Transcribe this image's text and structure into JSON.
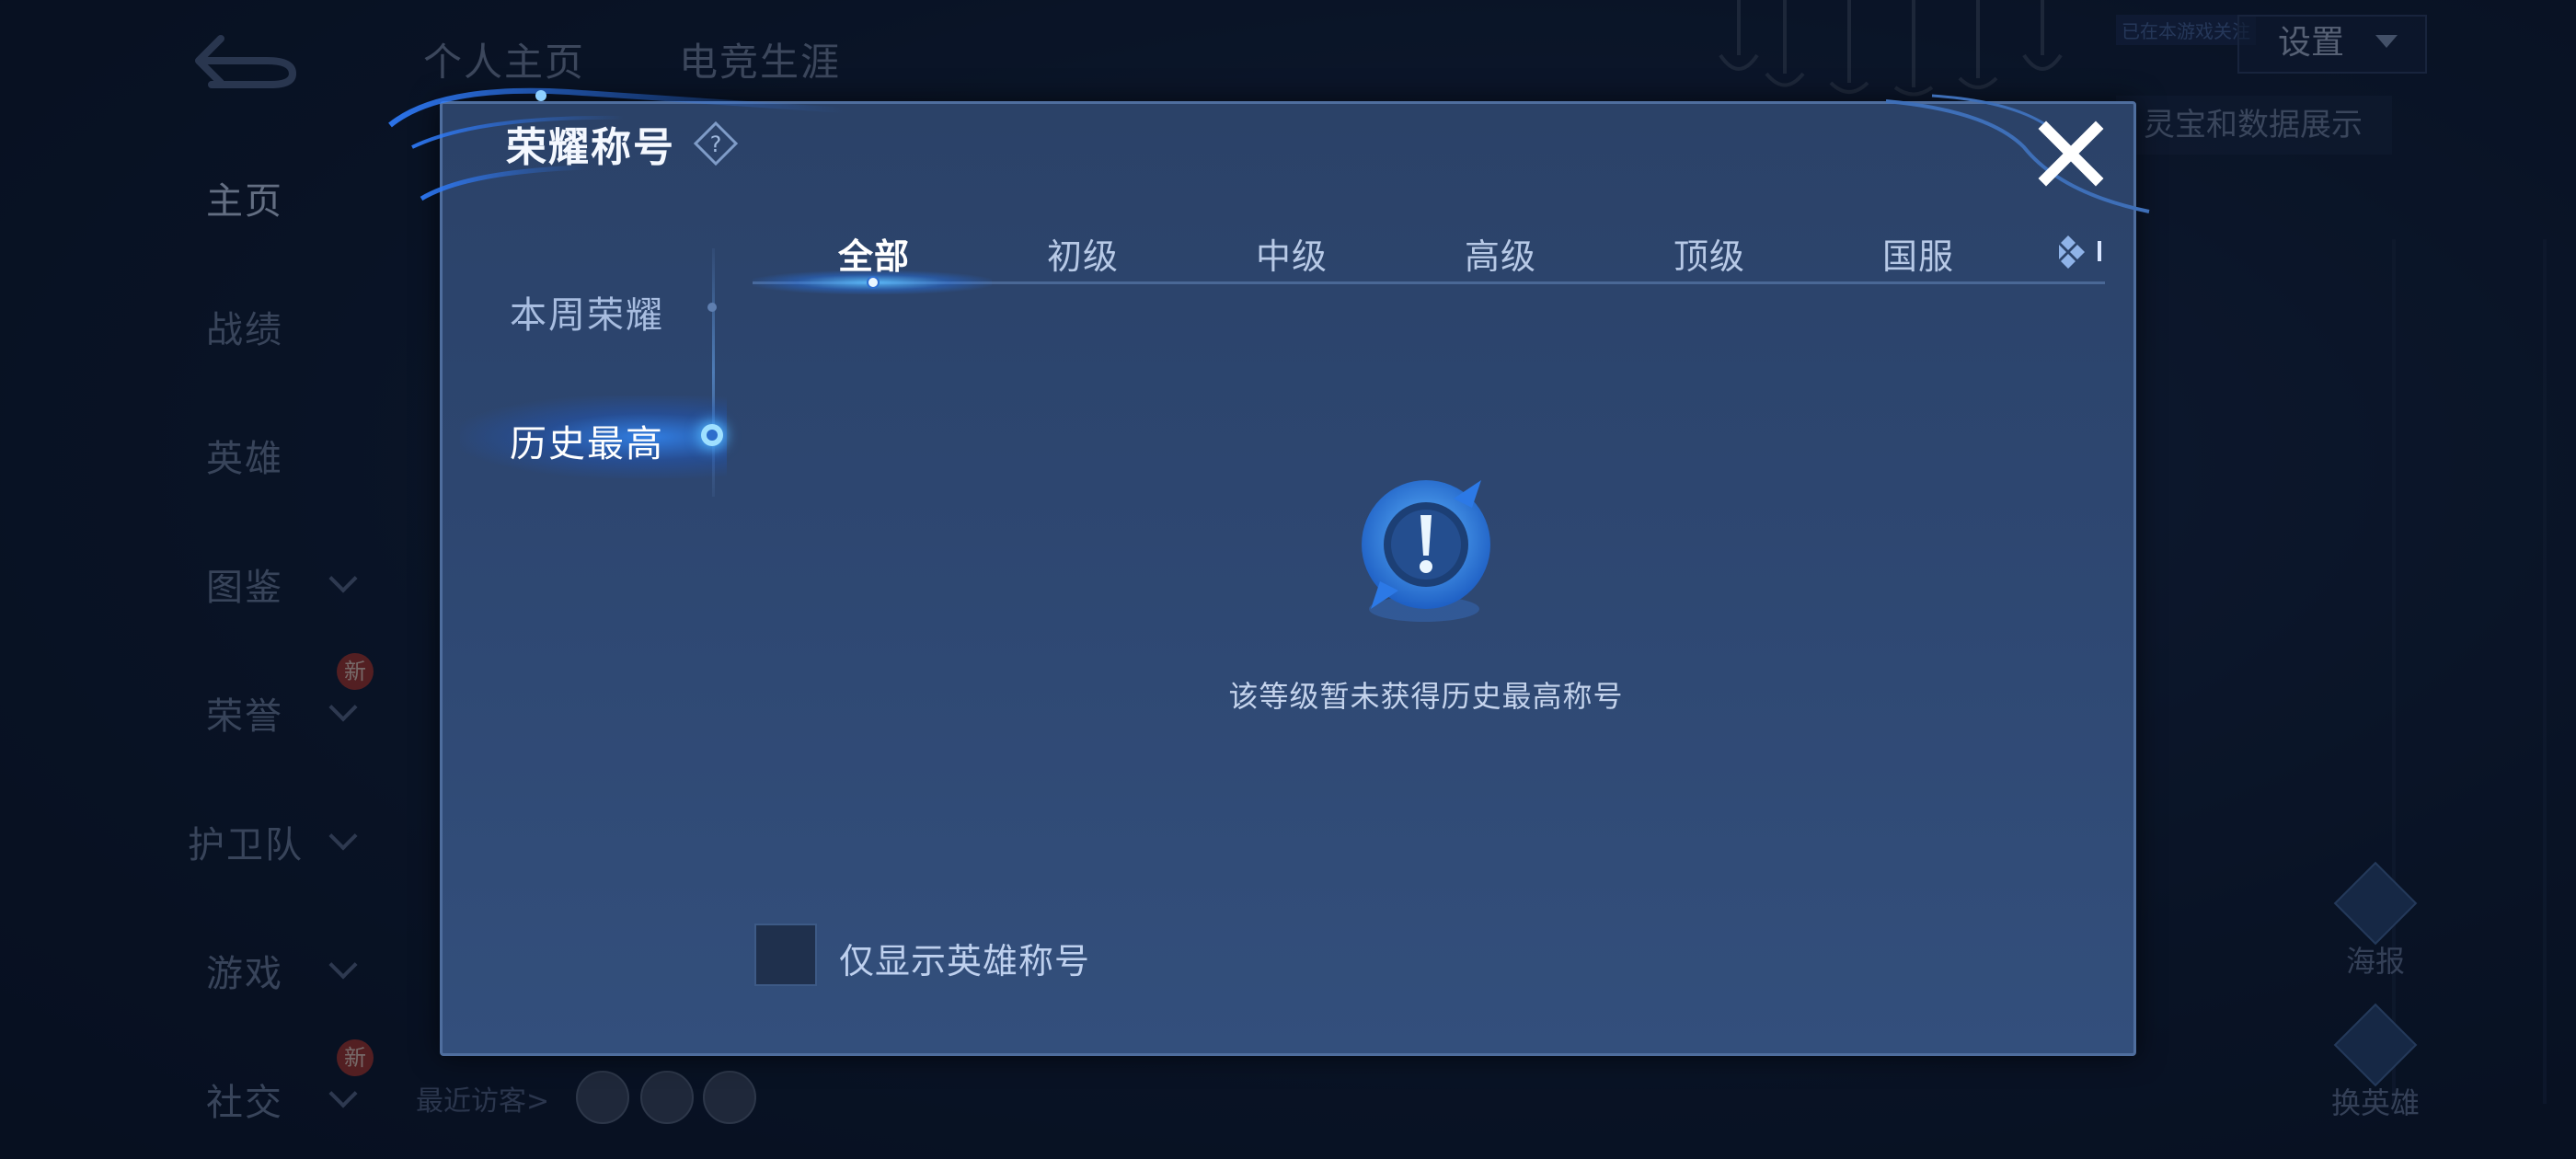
{
  "background": {
    "top_tabs": [
      "个人主页",
      "电竞生涯"
    ],
    "sidebar": [
      {
        "label": "主页",
        "active": true,
        "chevron": false,
        "badge": ""
      },
      {
        "label": "战绩",
        "active": false,
        "chevron": false,
        "badge": ""
      },
      {
        "label": "英雄",
        "active": false,
        "chevron": false,
        "badge": ""
      },
      {
        "label": "图鉴",
        "active": false,
        "chevron": true,
        "badge": ""
      },
      {
        "label": "荣誉",
        "active": false,
        "chevron": true,
        "badge": "新"
      },
      {
        "label": "护卫队",
        "active": false,
        "chevron": true,
        "badge": ""
      },
      {
        "label": "游戏",
        "active": false,
        "chevron": true,
        "badge": ""
      },
      {
        "label": "社交",
        "active": false,
        "chevron": true,
        "badge": "新"
      }
    ],
    "settings_label": "设置",
    "settings_note": "已在本游戏关注",
    "data_display_label": "灵宝和数据展示",
    "recent_visitors_label": "最近访客>",
    "right_buttons": [
      "海报",
      "换英雄"
    ]
  },
  "dialog": {
    "title": "荣耀称号",
    "side_tabs": [
      {
        "label": "本周荣耀",
        "active": false
      },
      {
        "label": "历史最高",
        "active": true
      }
    ],
    "tabs": [
      {
        "label": "全部",
        "active": true
      },
      {
        "label": "初级",
        "active": false
      },
      {
        "label": "中级",
        "active": false
      },
      {
        "label": "高级",
        "active": false
      },
      {
        "label": "顶级",
        "active": false
      },
      {
        "label": "国服",
        "active": false
      }
    ],
    "empty_message": "该等级暂未获得历史最高称号",
    "checkbox_label": "仅显示英雄称号",
    "checkbox_checked": false
  },
  "colors": {
    "accent": "#3a8cff",
    "dialog_bg": "#2d4670",
    "text_primary": "#ffffff",
    "text_secondary": "#b7c9e6"
  },
  "icons": [
    "back-arrow-icon",
    "help-icon",
    "close-icon",
    "more-tabs-icon",
    "exclamation-icon",
    "chevron-down-icon"
  ]
}
